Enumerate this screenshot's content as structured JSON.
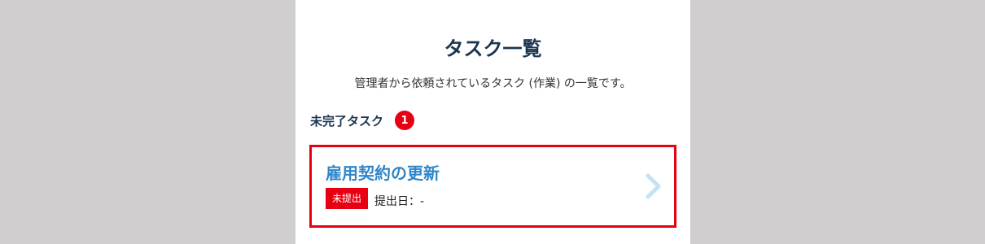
{
  "page": {
    "title": "タスク一覧",
    "description": "管理者から依頼されているタスク (作業) の一覧です。"
  },
  "section": {
    "label": "未完了タスク",
    "count": "1"
  },
  "tasks": [
    {
      "title": "雇用契約の更新",
      "status": "未提出",
      "due_date": "提出日：-"
    }
  ],
  "colors": {
    "background": "#d0cecf",
    "panel": "#ffffff",
    "title": "#1a3550",
    "accent_red": "#e60012",
    "task_title_blue": "#2f86c8",
    "chevron": "#c5e2f5"
  },
  "icons": {
    "task_arrow": "chevron-right-icon"
  }
}
